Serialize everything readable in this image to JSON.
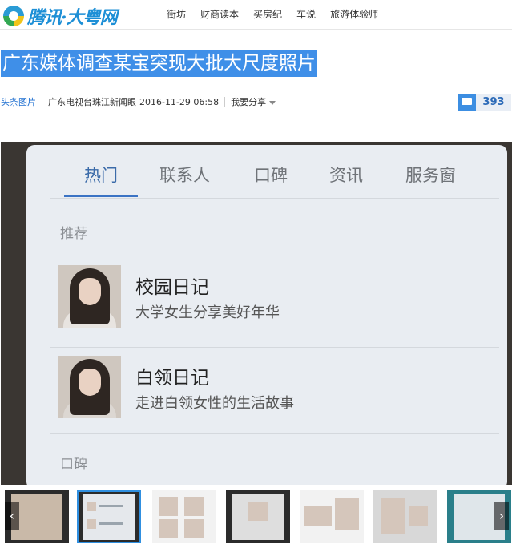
{
  "site": {
    "logo_text": "腾讯·大粤网"
  },
  "nav": [
    "街坊",
    "财商读本",
    "买房纪",
    "车说",
    "旅游体验师"
  ],
  "article": {
    "title": "广东媒体调查某宝突现大批大尺度照片",
    "category": "头条图片",
    "source": "广东电视台珠江新闻眼",
    "datetime": "2016-11-29 06:58",
    "share_label": "我要分享",
    "comment_count": "393"
  },
  "photo": {
    "tabs": [
      "热门",
      "联系人",
      "口碑",
      "资讯",
      "服务窗"
    ],
    "active_tab_index": 0,
    "section_recommend": "推荐",
    "items": [
      {
        "title": "校园日记",
        "subtitle": "大学女生分享美好年华"
      },
      {
        "title": "白领日记",
        "subtitle": "走进白领女性的生活故事"
      }
    ],
    "section_bottom": "口碑"
  },
  "gallery": {
    "selected_index": 1,
    "prev_icon": "chevron-left-icon",
    "next_icon": "chevron-right-icon",
    "prev_label": "‹",
    "next_label": "›"
  },
  "colors": {
    "accent": "#3f8fe8",
    "link": "#1f6fd0",
    "comment_bg": "#3c8ee2"
  }
}
